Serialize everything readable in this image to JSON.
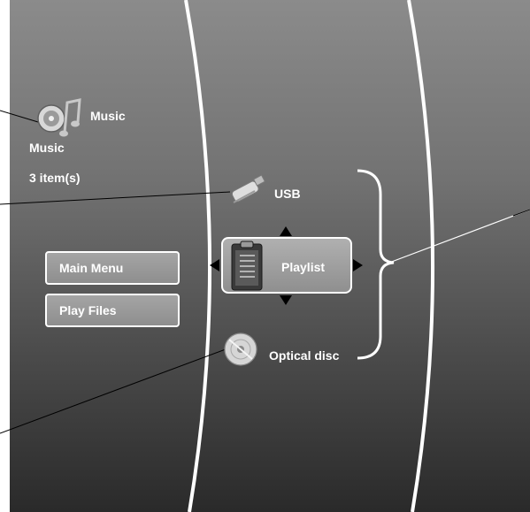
{
  "header": {
    "app_icon": "music-disc-icon",
    "app_label": "Music"
  },
  "info": {
    "category": "Music",
    "item_count": "3 item(s)"
  },
  "left_menu": {
    "items": [
      {
        "label": "Main Menu"
      },
      {
        "label": "Play Files"
      }
    ]
  },
  "sources": {
    "usb": {
      "label": "USB",
      "icon": "usb-drive-icon"
    },
    "playlist": {
      "label": "Playlist",
      "icon": "clipboard-list-icon",
      "selected": true
    },
    "optical": {
      "label": "Optical disc",
      "icon": "optical-disc-icon"
    }
  },
  "colors": {
    "screen_top": "#8b8b8b",
    "screen_bottom": "#2a2a2a",
    "outline": "#ffffff",
    "callout_line": "#000000"
  }
}
